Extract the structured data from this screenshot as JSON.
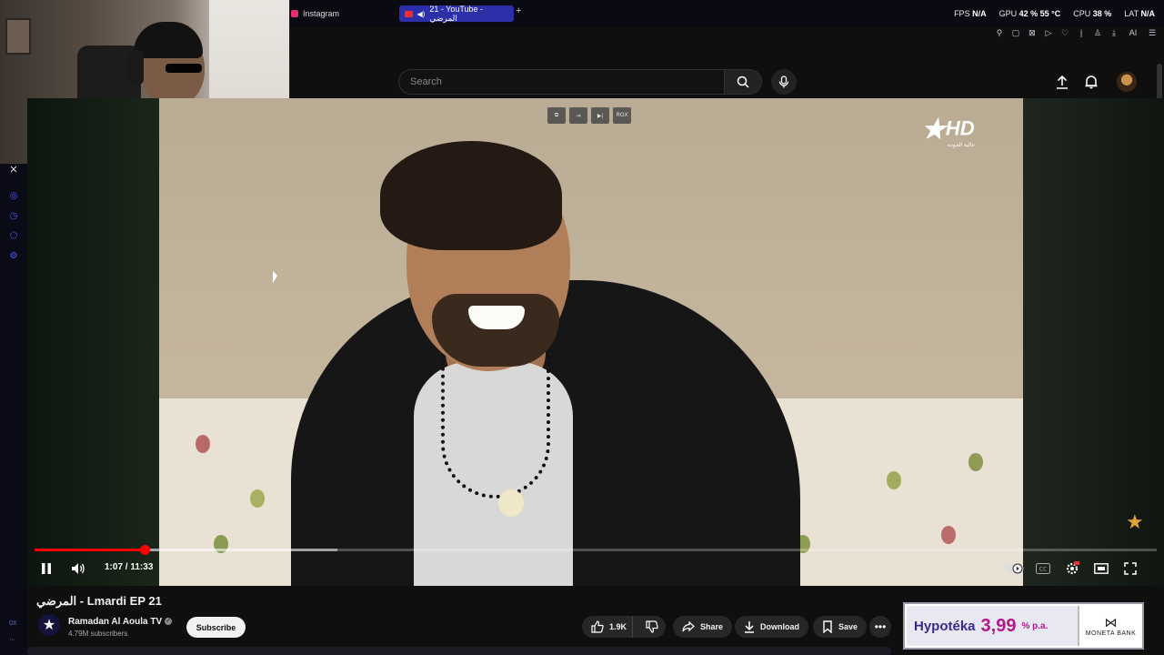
{
  "browser": {
    "tabs": [
      {
        "label": "Instagram"
      },
      {
        "label": "21 - YouTube - المرضي"
      }
    ],
    "stats": {
      "fps_label": "FPS",
      "fps_value": "N/A",
      "gpu_label": "GPU",
      "gpu_value": "42 % 55 °C",
      "cpu_label": "CPU",
      "cpu_value": "38 %",
      "lat_label": "LAT",
      "lat_value": "N/A"
    },
    "ai_label": "AI"
  },
  "masthead": {
    "search_placeholder": "Search"
  },
  "rail": {
    "zoom_label": "0X"
  },
  "player": {
    "tool_label": "RGX",
    "logo_hd": "HD",
    "logo_sub": "عالية الجودة",
    "time": "1:07 / 11:33",
    "progress_played": 0.098,
    "progress_buffered": 0.27
  },
  "video_info": {
    "title": "المرضي - Lmardi EP 21",
    "channel_name": "Ramadan Al Aoula TV",
    "subscribers": "4.79M subscribers",
    "subscribe_label": "Subscribe",
    "likes": "1.9K",
    "share_label": "Share",
    "download_label": "Download",
    "save_label": "Save"
  },
  "ad": {
    "headline": "Hypotéka",
    "rate": "3,99",
    "rate_suffix": "% p.a.",
    "brand_mark": "⋈",
    "brand": "MONETA BANK"
  }
}
